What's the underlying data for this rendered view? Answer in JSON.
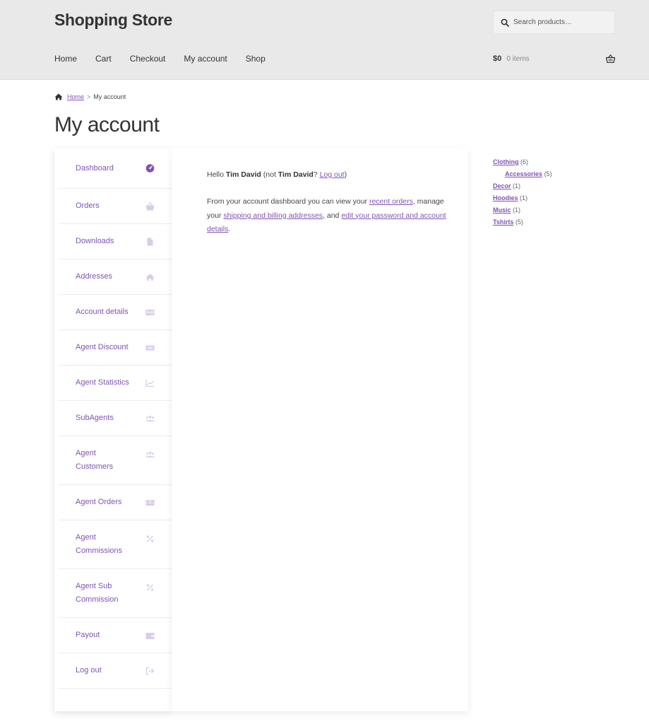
{
  "header": {
    "site_title": "Shopping Store",
    "search_placeholder": "Search products…",
    "nav": [
      "Home",
      "Cart",
      "Checkout",
      "My account",
      "Shop"
    ],
    "cart_amount": "$0",
    "cart_count": "0 items"
  },
  "breadcrumb": {
    "home": "Home",
    "sep": ">",
    "current": "My account"
  },
  "page_title": "My account",
  "account_nav": {
    "items": [
      {
        "label": "Dashboard",
        "icon": "dashboard-icon"
      },
      {
        "label": "Orders",
        "icon": "basket-icon"
      },
      {
        "label": "Downloads",
        "icon": "file-icon"
      },
      {
        "label": "Addresses",
        "icon": "home-icon"
      },
      {
        "label": "Account details",
        "icon": "id-card-icon"
      },
      {
        "label": "Agent Discount",
        "icon": "ticket-icon"
      },
      {
        "label": "Agent Statistics",
        "icon": "line-chart-icon"
      },
      {
        "label": "SubAgents",
        "icon": "users-icon"
      },
      {
        "label": "Agent Customers",
        "icon": "users-icon"
      },
      {
        "label": "Agent Orders",
        "icon": "boxes-icon"
      },
      {
        "label": "Agent Commissions",
        "icon": "percent-icon"
      },
      {
        "label": "Agent Sub Commission",
        "icon": "percent-icon"
      },
      {
        "label": "Payout",
        "icon": "wallet-icon"
      },
      {
        "label": "Log out",
        "icon": "sign-out-icon"
      }
    ]
  },
  "dashboard": {
    "hello": "Hello",
    "user": "Tim David",
    "not_open": "(not",
    "not_user": "Tim David",
    "q": "?",
    "logout": "Log out",
    "close": ")",
    "desc_1": "From your account dashboard you can view your",
    "link_orders": "recent orders",
    "desc_2": ", manage your",
    "link_addresses": "shipping and billing addresses",
    "desc_3": ", and",
    "link_account": "edit your password and account details",
    "desc_4": "."
  },
  "categories": [
    {
      "name": "Clothing",
      "count": "(6)",
      "sub": false
    },
    {
      "name": "Accessories",
      "count": "(5)",
      "sub": true
    },
    {
      "name": "Decor",
      "count": "(1)",
      "sub": false
    },
    {
      "name": "Hoodies",
      "count": "(1)",
      "sub": false
    },
    {
      "name": "Music",
      "count": "(1)",
      "sub": false
    },
    {
      "name": "Tshirts",
      "count": "(5)",
      "sub": false
    }
  ],
  "colors": {
    "accent": "#7f54b3",
    "header_bg": "#e9e9e9",
    "icon_muted": "#d9cce9"
  }
}
